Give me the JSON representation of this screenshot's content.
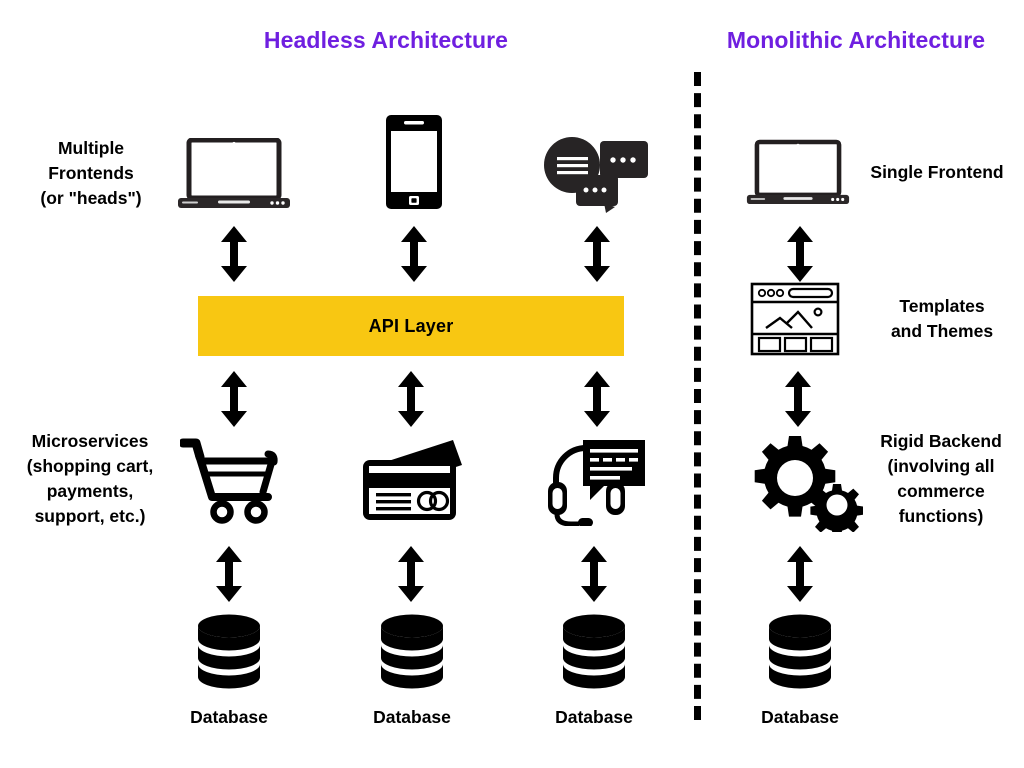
{
  "diagram": {
    "type": "comparison-diagram",
    "background": "#ffffff",
    "accent_title_color": "#6f1fe0",
    "api_bar_color": "#f8c712",
    "icon_color": "#000000"
  },
  "titles": {
    "left": "Headless Architecture",
    "right": "Monolithic Architecture"
  },
  "left_column": {
    "row_labels": {
      "frontends": "Multiple\nFrontends\n(or \"heads\")",
      "frontends_lines": [
        "Multiple",
        "Frontends",
        "(or \"heads\")"
      ],
      "microservices_lines": [
        "Microservices",
        "(shopping cart,",
        "payments,",
        "support, etc.)"
      ]
    },
    "api_layer": "API Layer",
    "frontend_icons": [
      "laptop-icon",
      "smartphone-icon",
      "chat-bubbles-icon"
    ],
    "service_icons": [
      "shopping-cart-icon",
      "credit-card-icon",
      "support-headset-icon"
    ],
    "database_labels": [
      "Database",
      "Database",
      "Database"
    ]
  },
  "right_column": {
    "row_labels": {
      "frontend": "Single Frontend",
      "templates_lines": [
        "Templates",
        "and Themes"
      ],
      "backend_lines": [
        "Rigid Backend",
        "(involving all",
        "commerce",
        "functions)"
      ]
    },
    "icons": [
      "laptop-icon",
      "browser-template-icon",
      "gears-icon",
      "database-icon"
    ],
    "database_label": "Database"
  },
  "connectors": {
    "style": "double-headed-vertical-arrow",
    "count_left": 9,
    "count_right": 3
  }
}
